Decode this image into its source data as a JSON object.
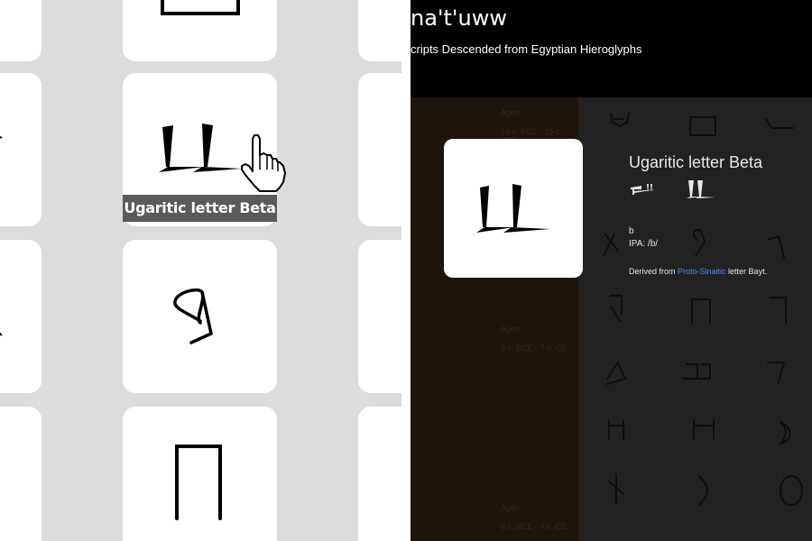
{
  "header": {
    "title": "na't'uww",
    "subtitle": "cripts Descended from Egyptian Hieroglyphs"
  },
  "tooltip": {
    "text": "Ugaritic letter Beta"
  },
  "timeline": [
    {
      "label": "Ages",
      "range": "19 c. BCE - 15 c. BCE"
    },
    {
      "label": "Ages",
      "range": "8 c. BCE - 7 c. CE"
    },
    {
      "label": "Ages",
      "range": "8 c. BCE - 4 c. CE"
    }
  ],
  "detail": {
    "name": "Ugaritic letter Beta",
    "latin": "b",
    "ipa": "IPA: /b/",
    "derived_prefix": "Derived from ",
    "derived_link": "Proto-Sinaitic",
    "derived_suffix": " letter Bayt."
  },
  "icons": {
    "cursor": "hand-pointer-icon",
    "glyph_ugaritic_beta": "ugaritic-beta-glyph",
    "glyph_phoenician_bet": "bet-glyph",
    "glyph_pi": "pi-glyph"
  },
  "colors": {
    "link": "#4a90e2",
    "tooltip_bg": "#5a5a5a",
    "age_column": "#241a0f",
    "grid_bg": "#2a2a2a"
  }
}
